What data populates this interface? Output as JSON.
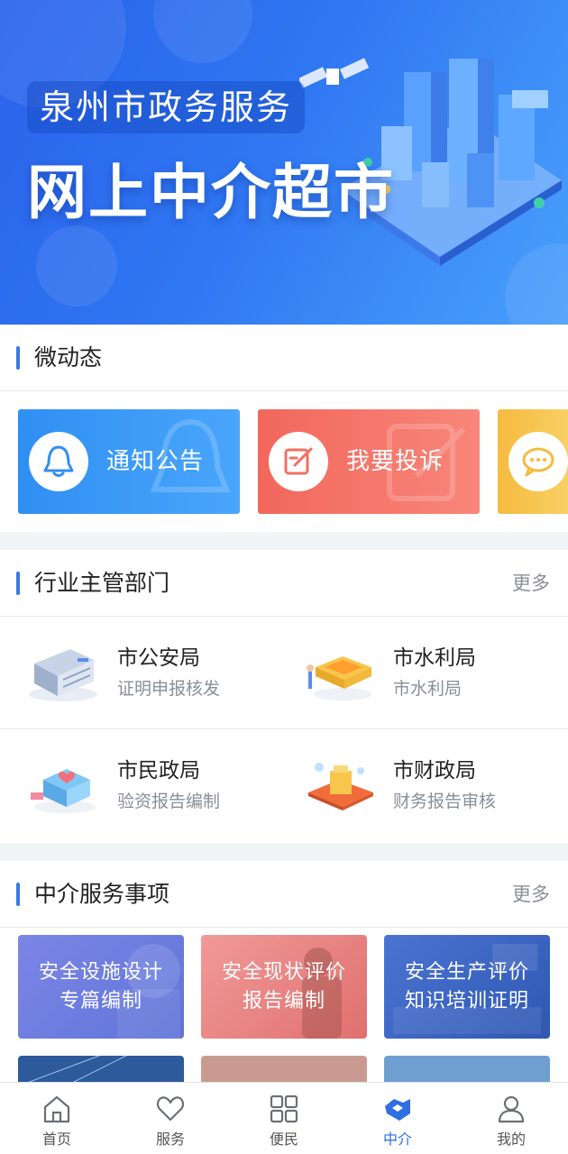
{
  "banner": {
    "subtitle": "泉州市政务服务",
    "title": "网上中介超市"
  },
  "news": {
    "title": "微动态",
    "cards": [
      {
        "label": "通知公告",
        "icon": "bell-icon",
        "color": "#2f8ff2"
      },
      {
        "label": "我要投诉",
        "icon": "edit-icon",
        "color": "#f36f63"
      },
      {
        "label": "",
        "icon": "chat-icon",
        "color": "#f6c24a"
      }
    ]
  },
  "departments": {
    "title": "行业主管部门",
    "more": "更多",
    "items": [
      {
        "name": "市公安局",
        "desc": "证明申报核发",
        "icon": "office-building-icon"
      },
      {
        "name": "市水利局",
        "desc": "市水利局",
        "icon": "water-pool-icon"
      },
      {
        "name": "市民政局",
        "desc": "验资报告编制",
        "icon": "heart-shop-icon"
      },
      {
        "name": "市财政局",
        "desc": "财务报告审核",
        "icon": "money-platform-icon"
      }
    ]
  },
  "services": {
    "title": "中介服务事项",
    "more": "更多",
    "tiles": [
      {
        "line1": "安全设施设计",
        "line2": "专篇编制",
        "color": "#6f7fe0"
      },
      {
        "line1": "安全现状评价",
        "line2": "报告编制",
        "color": "#e8797a"
      },
      {
        "line1": "安全生产评价",
        "line2": "知识培训证明",
        "color": "#3f69c8"
      },
      {
        "line1": "",
        "line2": "",
        "color": "#2c5a9a"
      },
      {
        "line1": "",
        "line2": "",
        "color": "#c99a92"
      },
      {
        "line1": "",
        "line2": "",
        "color": "#6f9fd0"
      }
    ]
  },
  "tabbar": {
    "items": [
      {
        "label": "首页",
        "icon": "home-icon"
      },
      {
        "label": "服务",
        "icon": "heart-icon"
      },
      {
        "label": "便民",
        "icon": "grid-icon"
      },
      {
        "label": "中介",
        "icon": "handshake-icon",
        "active": true
      },
      {
        "label": "我的",
        "icon": "user-icon"
      }
    ]
  },
  "colors": {
    "accent": "#3a78e6",
    "active_tab": "#2f6fe0"
  }
}
